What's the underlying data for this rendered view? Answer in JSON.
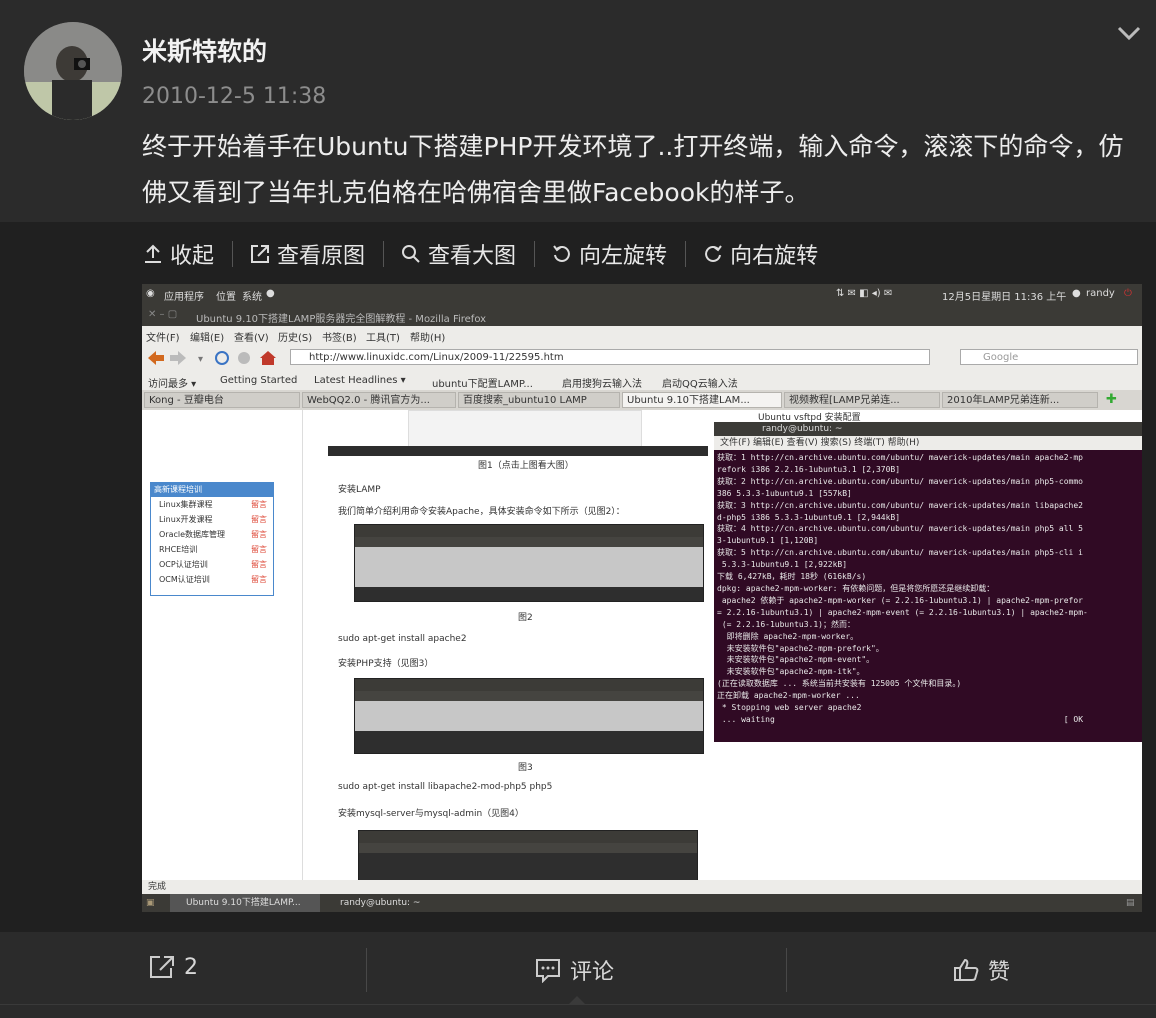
{
  "post": {
    "author": "米斯特软的",
    "time": "2010-12-5 11:38",
    "text": "终于开始着手在Ubuntu下搭建PHP开发环境了..打开终端，输入命令，滚滚下的命令，仿佛又看到了当年扎克伯格在哈佛宿舍里做Facebook的样子。"
  },
  "toolbar": {
    "collapse": "收起",
    "view_original": "查看原图",
    "view_large": "查看大图",
    "rotate_left": "向左旋转",
    "rotate_right": "向右旋转"
  },
  "screenshot": {
    "gnome_top": {
      "menu1": "应用程序",
      "menu2": "位置",
      "menu3": "系统",
      "clock": "12月5日星期日 11:36 上午",
      "user": "randy"
    },
    "window_title": "Ubuntu 9.10下搭建LAMP服务器完全图解教程 - Mozilla Firefox",
    "menus": [
      "文件(F)",
      "编辑(E)",
      "查看(V)",
      "历史(S)",
      "书签(B)",
      "工具(T)",
      "帮助(H)"
    ],
    "url": "http://www.linuxidc.com/Linux/2009-11/22595.htm",
    "search_placeholder": "Google",
    "bookmarks": [
      "访问最多 ▾",
      "Getting Started",
      "Latest Headlines ▾",
      "ubuntu下配置LAMP...",
      "启用搜狗云输入法",
      "启动QQ云输入法"
    ],
    "tabs": [
      "Kong - 豆瓣电台",
      "WebQQ2.0 - 腾讯官方为...",
      "百度搜索_ubuntu10 LAMP",
      "Ubuntu 9.10下搭建LAM...",
      "视频教程[LAMP兄弟连...",
      "2010年LAMP兄弟连新..."
    ],
    "sidebox": {
      "title": "高新课程培训",
      "rows": [
        "Linux集群课程",
        "Linux开发课程",
        "Oracle数据库管理",
        "RHCE培训",
        "OCP认证培训",
        "OCM认证培训"
      ],
      "tag": "留言"
    },
    "article": {
      "fig1": "图1（点击上图看大图）",
      "install_lamp": "安装LAMP",
      "intro": "我们简单介绍利用命令安装Apache，具体安装命令如下所示（见图2）：",
      "fig2": "图2",
      "cmd1": "sudo apt-get install apache2",
      "install_php": "安装PHP支持（见图3）",
      "fig3": "图3",
      "cmd2": "sudo apt-get install libapache2-mod-php5 php5",
      "install_mysql": "安装mysql-server与mysql-admin（见图4）"
    },
    "terminal": {
      "title": "randy@ubuntu: ~",
      "menu": "文件(F)  编辑(E)  查看(V)  搜索(S)  终端(T)  帮助(H)",
      "side_tab": "Ubuntu vsftpd 安装配置",
      "lines": [
        "获取：1 http://cn.archive.ubuntu.com/ubuntu/ maverick-updates/main apache2-mp",
        "refork i386 2.2.16-1ubuntu3.1 [2,370B]",
        "获取：2 http://cn.archive.ubuntu.com/ubuntu/ maverick-updates/main php5-commo",
        "386 5.3.3-1ubuntu9.1 [557kB]",
        "获取：3 http://cn.archive.ubuntu.com/ubuntu/ maverick-updates/main libapache2",
        "d-php5 i386 5.3.3-1ubuntu9.1 [2,944kB]",
        "获取：4 http://cn.archive.ubuntu.com/ubuntu/ maverick-updates/main php5 all 5",
        "3-1ubuntu9.1 [1,120B]",
        "获取：5 http://cn.archive.ubuntu.com/ubuntu/ maverick-updates/main php5-cli i",
        " 5.3.3-1ubuntu9.1 [2,922kB]",
        "下载 6,427kB，耗时 18秒 (616kB/s)",
        "dpkg: apache2-mpm-worker: 有依赖问题，但是将您所愿还是继续卸载：",
        " apache2 依赖于 apache2-mpm-worker (= 2.2.16-1ubuntu3.1) | apache2-mpm-prefor",
        "= 2.2.16-1ubuntu3.1) | apache2-mpm-event (= 2.2.16-1ubuntu3.1) | apache2-mpm-",
        " (= 2.2.16-1ubuntu3.1)；然而：",
        "  即将删除 apache2-mpm-worker。",
        "  未安装软件包\"apache2-mpm-prefork\"。",
        "  未安装软件包\"apache2-mpm-event\"。",
        "  未安装软件包\"apache2-mpm-itk\"。",
        "(正在读取数据库 ... 系统当前共安装有 125005 个文件和目录。)",
        "正在卸载 apache2-mpm-worker ...",
        " * Stopping web server apache2",
        " ... waiting                                                            [ OK"
      ]
    },
    "status": "完成",
    "taskbar": [
      "Ubuntu 9.10下搭建LAMP...",
      "randy@ubuntu: ~"
    ]
  },
  "footer": {
    "repost_count": "2",
    "comment": "评论",
    "like": "赞"
  }
}
